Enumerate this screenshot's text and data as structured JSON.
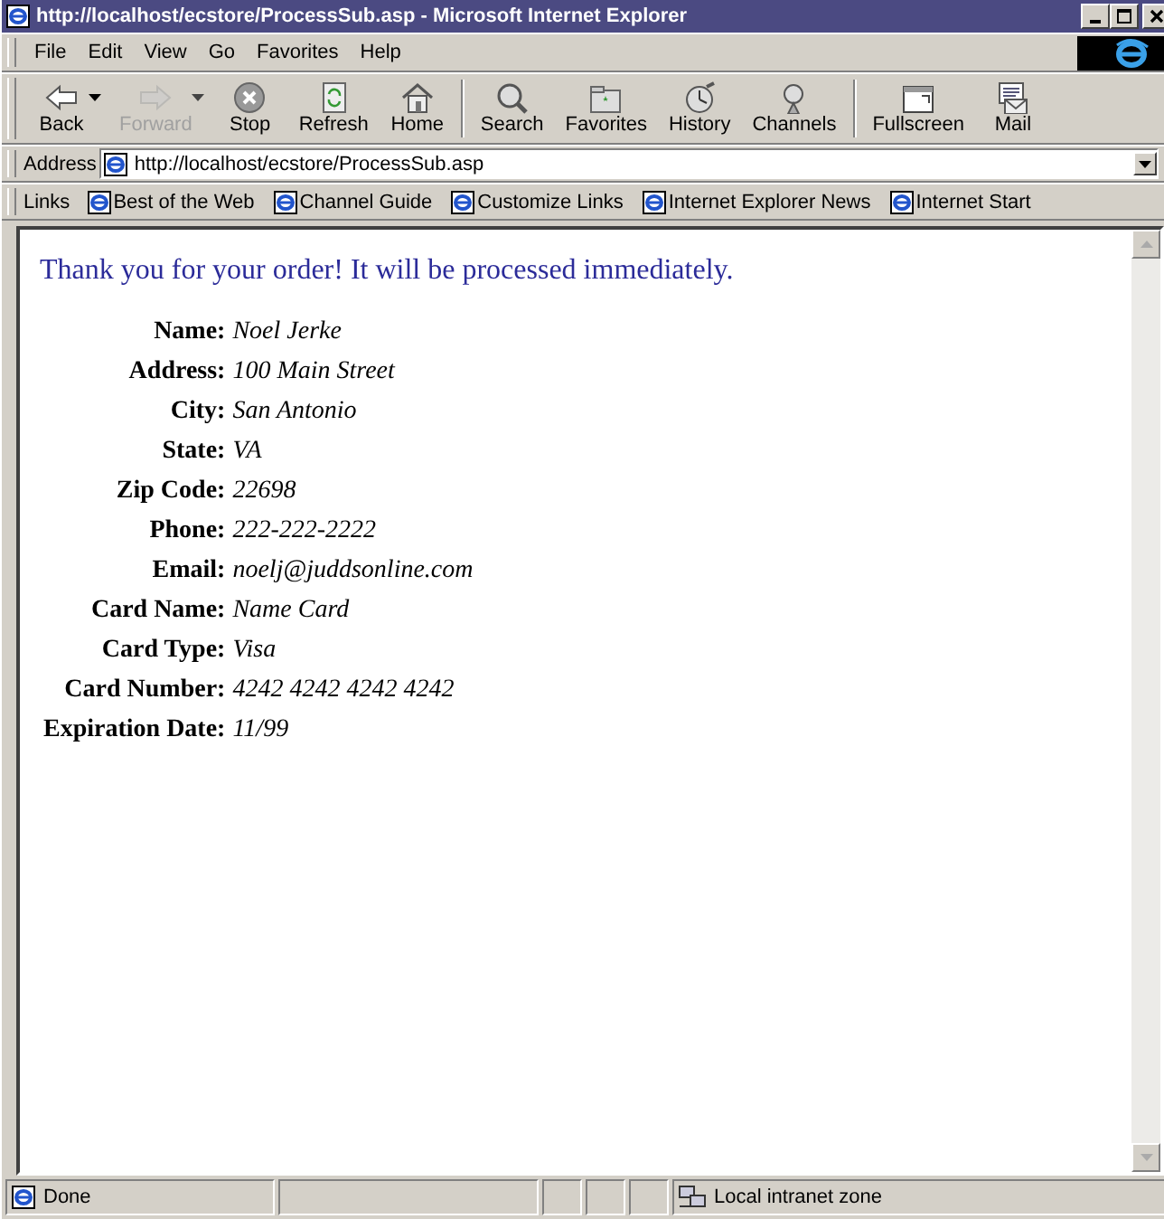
{
  "window": {
    "title": "http://localhost/ecstore/ProcessSub.asp - Microsoft Internet Explorer"
  },
  "menu": [
    "File",
    "Edit",
    "View",
    "Go",
    "Favorites",
    "Help"
  ],
  "toolbar": [
    {
      "label": "Back",
      "kind": "back",
      "disabled": false
    },
    {
      "label": "Forward",
      "kind": "forward",
      "disabled": true
    },
    {
      "label": "Stop",
      "kind": "stop",
      "disabled": false
    },
    {
      "label": "Refresh",
      "kind": "refresh",
      "disabled": false
    },
    {
      "label": "Home",
      "kind": "home",
      "disabled": false
    },
    {
      "label": "Search",
      "kind": "search",
      "disabled": false
    },
    {
      "label": "Favorites",
      "kind": "favorites",
      "disabled": false
    },
    {
      "label": "History",
      "kind": "history",
      "disabled": false
    },
    {
      "label": "Channels",
      "kind": "channels",
      "disabled": false
    },
    {
      "label": "Fullscreen",
      "kind": "fullscreen",
      "disabled": false
    },
    {
      "label": "Mail",
      "kind": "mail",
      "disabled": false
    }
  ],
  "address": {
    "label": "Address",
    "value": "http://localhost/ecstore/ProcessSub.asp"
  },
  "links": {
    "label": "Links",
    "items": [
      "Best of the Web",
      "Channel Guide",
      "Customize Links",
      "Internet Explorer News",
      "Internet Start"
    ]
  },
  "page": {
    "heading": "Thank you for your order! It will be processed immediately.",
    "fields": [
      {
        "label": "Name:",
        "value": "Noel Jerke"
      },
      {
        "label": "Address:",
        "value": "100 Main Street"
      },
      {
        "label": "City:",
        "value": "San Antonio"
      },
      {
        "label": "State:",
        "value": "VA"
      },
      {
        "label": "Zip Code:",
        "value": "22698"
      },
      {
        "label": "Phone:",
        "value": "222-222-2222"
      },
      {
        "label": "Email:",
        "value": "noelj@juddsonline.com"
      },
      {
        "label": "Card Name:",
        "value": "Name Card"
      },
      {
        "label": "Card Type:",
        "value": "Visa"
      },
      {
        "label": "Card Number:",
        "value": "4242 4242 4242 4242"
      },
      {
        "label": "Expiration Date:",
        "value": "11/99"
      }
    ]
  },
  "status_bar": {
    "text": "Done",
    "zone": "Local intranet zone"
  }
}
